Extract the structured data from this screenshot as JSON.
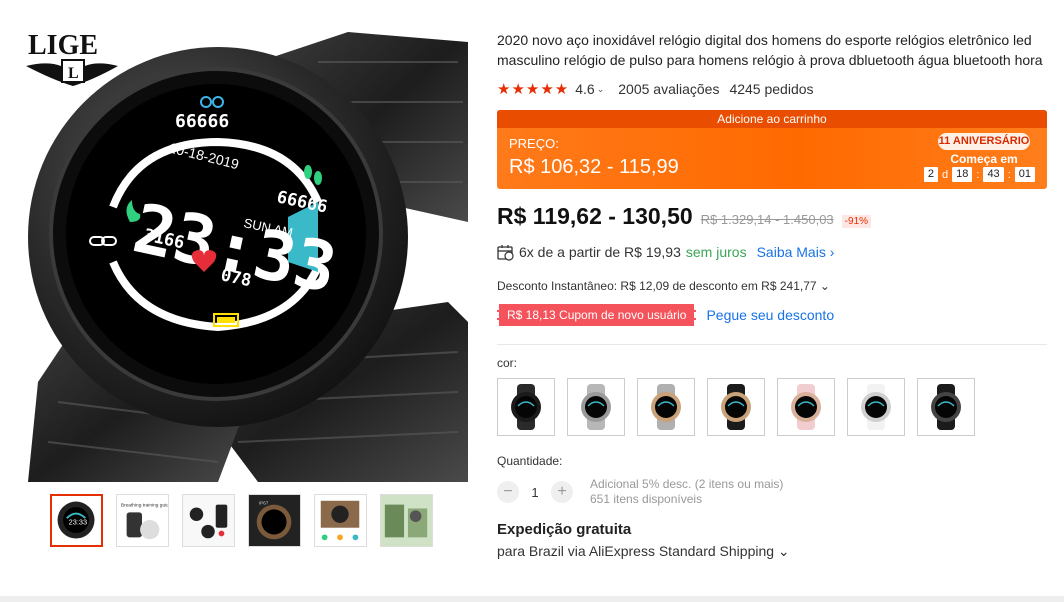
{
  "brand": {
    "logo_text": "LIGE",
    "logo_emblem": "L"
  },
  "watch_face": {
    "steps_top": "66666",
    "date": "10-18-2019",
    "time": "23:33",
    "day": "SUN AM",
    "steps_right": "66666",
    "calories": "3166",
    "heart_rate": "078"
  },
  "gallery": {
    "thumb_count": 6,
    "active_index": 0
  },
  "product": {
    "title": "2020 novo aço inoxidável relógio digital dos homens do esporte relógios eletrônico led masculino relógio de pulso para homens relógio à prova dbluetooth água bluetooth hora"
  },
  "rating": {
    "stars": "★★★★★",
    "value": "4.6",
    "caret": "⌄",
    "reviews": "2005 avaliações",
    "orders": "4245 pedidos"
  },
  "promo": {
    "tag": "Adicione ao carrinho",
    "label": "PREÇO:",
    "price": "R$ 106,32 - 115,99",
    "badge": "11 ANIVERSÁRIO",
    "starts": "Começa em",
    "countdown": {
      "days": "2",
      "d_label": "d",
      "hours": "18",
      "minutes": "43",
      "seconds": "01"
    }
  },
  "price": {
    "current": "R$ 119,62 - 130,50",
    "original": "R$ 1.329,14 - 1.450,03",
    "discount": "-91%"
  },
  "installments": {
    "text": "6x de a partir de R$ 19,93",
    "juros": "sem juros",
    "link": "Saiba Mais"
  },
  "instant_discount": {
    "text": "Desconto Instantâneo: R$ 12,09 de desconto em R$ 241,77 ⌄"
  },
  "coupon": {
    "label": "R$ 18,13 Cupom de novo usuário",
    "link": "Pegue seu desconto"
  },
  "colors": {
    "label": "cor:",
    "options": [
      {
        "name": "black-steel",
        "case": "#1b1b1b",
        "band": "#2a2a2a"
      },
      {
        "name": "silver-steel",
        "case": "#9a9a9a",
        "band": "#b7b7b7"
      },
      {
        "name": "gold-steel",
        "case": "#c9a27a",
        "band": "#b0b0b0"
      },
      {
        "name": "black-gold-silicone",
        "case": "#c9a27a",
        "band": "#1b1b1b"
      },
      {
        "name": "pink-silicone",
        "case": "#d9b19a",
        "band": "#f2cdd0"
      },
      {
        "name": "white-silicone",
        "case": "#cfcfcf",
        "band": "#f2f2f2"
      },
      {
        "name": "black-silicone",
        "case": "#444444",
        "band": "#1b1b1b"
      }
    ]
  },
  "quantity": {
    "label": "Quantidade:",
    "minus": "−",
    "value": "1",
    "plus": "+",
    "extra": "Adicional 5% desc. (2 itens ou mais)",
    "available": "651 itens disponíveis"
  },
  "shipping": {
    "title": "Expedição gratuita",
    "detail": "para Brazil via AliExpress Standard Shipping ⌄"
  }
}
